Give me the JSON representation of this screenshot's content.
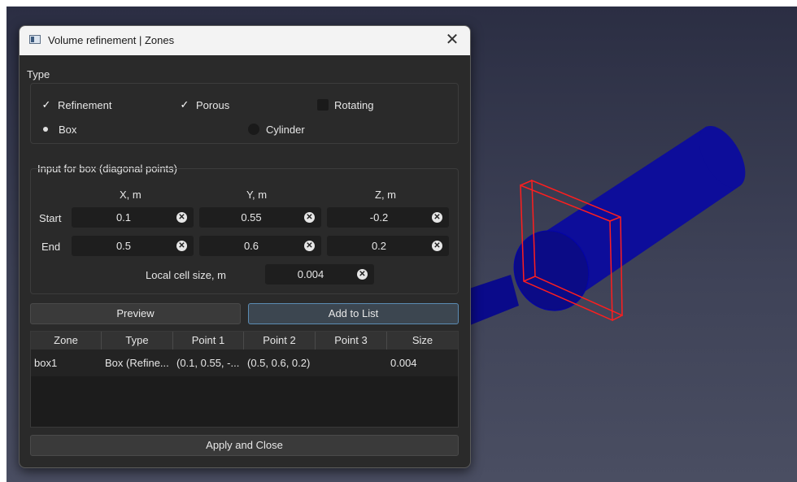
{
  "window": {
    "title": "Volume refinement | Zones",
    "close_glyph": "✕"
  },
  "type_group": {
    "label": "Type",
    "refinement": {
      "label": "Refinement",
      "checked": true
    },
    "porous": {
      "label": "Porous",
      "checked": true
    },
    "rotating": {
      "label": "Rotating",
      "checked": false
    },
    "box": {
      "label": "Box",
      "selected": true
    },
    "cylinder": {
      "label": "Cylinder",
      "selected": false
    }
  },
  "box_group": {
    "label": "Input for box (diagonal points)",
    "col_x": "X, m",
    "col_y": "Y, m",
    "col_z": "Z, m",
    "start_label": "Start",
    "end_label": "End",
    "start": {
      "x": "0.1",
      "y": "0.55",
      "z": "-0.2"
    },
    "end": {
      "x": "0.5",
      "y": "0.6",
      "z": "0.2"
    },
    "cell_size_label": "Local cell size, m",
    "cell_size": "0.004"
  },
  "buttons": {
    "preview": "Preview",
    "add": "Add to List",
    "apply": "Apply and Close"
  },
  "table": {
    "headers": [
      "Zone",
      "Type",
      "Point 1",
      "Point 2",
      "Point 3",
      "Size"
    ],
    "rows": [
      [
        "box1",
        "Box (Refine...",
        "(0.1, 0.55, -...",
        "(0.5, 0.6, 0.2)",
        "",
        "0.004"
      ]
    ]
  },
  "colors": {
    "viewport_bg": "#3e4257",
    "cylinder": "#0d0d9a",
    "box_outline": "#ff1e1e",
    "primary_border": "#5b8cb4"
  },
  "icons": {
    "window": "window-icon",
    "clear": "clear-circle-icon",
    "check": "checkmark-icon"
  }
}
